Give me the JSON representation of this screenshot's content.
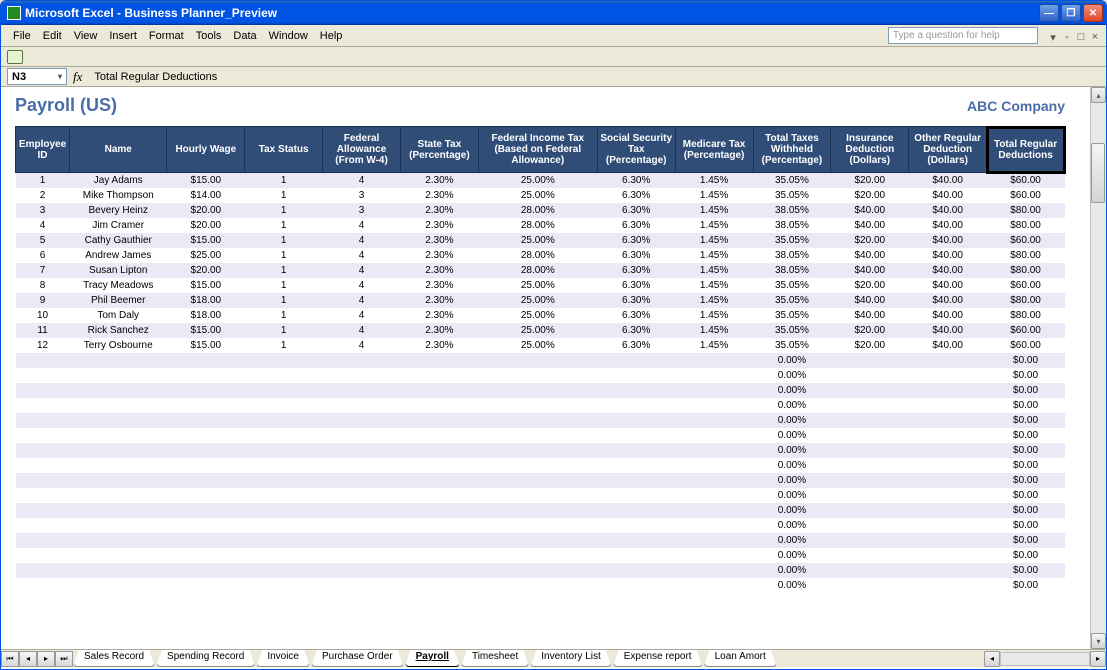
{
  "app": {
    "title": "Microsoft Excel - Business Planner_Preview"
  },
  "menu": {
    "items": [
      "File",
      "Edit",
      "View",
      "Insert",
      "Format",
      "Tools",
      "Data",
      "Window",
      "Help"
    ],
    "help_placeholder": "Type a question for help"
  },
  "formulabar": {
    "cell_ref": "N3",
    "fx": "fx",
    "value": "Total Regular Deductions"
  },
  "sheet": {
    "title": "Payroll (US)",
    "company": "ABC Company"
  },
  "headers": [
    "Employee ID",
    "Name",
    "Hourly Wage",
    "Tax Status",
    "Federal Allowance (From W-4)",
    "State Tax (Percentage)",
    "Federal Income Tax (Based on Federal Allowance)",
    "Social Security Tax (Percentage)",
    "Medicare Tax (Percentage)",
    "Total Taxes Withheld (Percentage)",
    "Insurance Deduction (Dollars)",
    "Other Regular Deduction (Dollars)",
    "Total Regular Deductions"
  ],
  "rows": [
    {
      "id": "1",
      "name": "Jay Adams",
      "wage": "$15.00",
      "tax": "1",
      "fed": "4",
      "state": "2.30%",
      "fit": "25.00%",
      "ss": "6.30%",
      "med": "1.45%",
      "tot": "35.05%",
      "ins": "$20.00",
      "oth": "$40.00",
      "trd": "$60.00"
    },
    {
      "id": "2",
      "name": "Mike Thompson",
      "wage": "$14.00",
      "tax": "1",
      "fed": "3",
      "state": "2.30%",
      "fit": "25.00%",
      "ss": "6.30%",
      "med": "1.45%",
      "tot": "35.05%",
      "ins": "$20.00",
      "oth": "$40.00",
      "trd": "$60.00"
    },
    {
      "id": "3",
      "name": "Bevery Heinz",
      "wage": "$20.00",
      "tax": "1",
      "fed": "3",
      "state": "2.30%",
      "fit": "28.00%",
      "ss": "6.30%",
      "med": "1.45%",
      "tot": "38.05%",
      "ins": "$40.00",
      "oth": "$40.00",
      "trd": "$80.00"
    },
    {
      "id": "4",
      "name": "Jim Cramer",
      "wage": "$20.00",
      "tax": "1",
      "fed": "4",
      "state": "2.30%",
      "fit": "28.00%",
      "ss": "6.30%",
      "med": "1.45%",
      "tot": "38.05%",
      "ins": "$40.00",
      "oth": "$40.00",
      "trd": "$80.00"
    },
    {
      "id": "5",
      "name": "Cathy Gauthier",
      "wage": "$15.00",
      "tax": "1",
      "fed": "4",
      "state": "2.30%",
      "fit": "25.00%",
      "ss": "6.30%",
      "med": "1.45%",
      "tot": "35.05%",
      "ins": "$20.00",
      "oth": "$40.00",
      "trd": "$60.00"
    },
    {
      "id": "6",
      "name": "Andrew James",
      "wage": "$25.00",
      "tax": "1",
      "fed": "4",
      "state": "2.30%",
      "fit": "28.00%",
      "ss": "6.30%",
      "med": "1.45%",
      "tot": "38.05%",
      "ins": "$40.00",
      "oth": "$40.00",
      "trd": "$80.00"
    },
    {
      "id": "7",
      "name": "Susan Lipton",
      "wage": "$20.00",
      "tax": "1",
      "fed": "4",
      "state": "2.30%",
      "fit": "28.00%",
      "ss": "6.30%",
      "med": "1.45%",
      "tot": "38.05%",
      "ins": "$40.00",
      "oth": "$40.00",
      "trd": "$80.00"
    },
    {
      "id": "8",
      "name": "Tracy Meadows",
      "wage": "$15.00",
      "tax": "1",
      "fed": "4",
      "state": "2.30%",
      "fit": "25.00%",
      "ss": "6.30%",
      "med": "1.45%",
      "tot": "35.05%",
      "ins": "$20.00",
      "oth": "$40.00",
      "trd": "$60.00"
    },
    {
      "id": "9",
      "name": "Phil Beemer",
      "wage": "$18.00",
      "tax": "1",
      "fed": "4",
      "state": "2.30%",
      "fit": "25.00%",
      "ss": "6.30%",
      "med": "1.45%",
      "tot": "35.05%",
      "ins": "$40.00",
      "oth": "$40.00",
      "trd": "$80.00"
    },
    {
      "id": "10",
      "name": "Tom Daly",
      "wage": "$18.00",
      "tax": "1",
      "fed": "4",
      "state": "2.30%",
      "fit": "25.00%",
      "ss": "6.30%",
      "med": "1.45%",
      "tot": "35.05%",
      "ins": "$40.00",
      "oth": "$40.00",
      "trd": "$80.00"
    },
    {
      "id": "11",
      "name": "Rick Sanchez",
      "wage": "$15.00",
      "tax": "1",
      "fed": "4",
      "state": "2.30%",
      "fit": "25.00%",
      "ss": "6.30%",
      "med": "1.45%",
      "tot": "35.05%",
      "ins": "$20.00",
      "oth": "$40.00",
      "trd": "$60.00"
    },
    {
      "id": "12",
      "name": "Terry Osbourne",
      "wage": "$15.00",
      "tax": "1",
      "fed": "4",
      "state": "2.30%",
      "fit": "25.00%",
      "ss": "6.30%",
      "med": "1.45%",
      "tot": "35.05%",
      "ins": "$20.00",
      "oth": "$40.00",
      "trd": "$60.00"
    }
  ],
  "empty_row": {
    "tot": "0.00%",
    "trd": "$0.00"
  },
  "empty_count": 16,
  "tabs": [
    "Sales Record",
    "Spending Record",
    "Invoice",
    "Purchase Order",
    "Payroll",
    "Timesheet",
    "Inventory List",
    "Expense report",
    "Loan Amort"
  ],
  "active_tab_index": 4
}
